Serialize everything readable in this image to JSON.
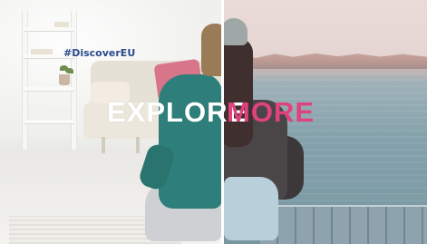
{
  "hashtag": "#DiscoverEU",
  "headline": {
    "left_word": "EXPLORE",
    "right_word": "MORE"
  },
  "colors": {
    "hashtag": "#2a4b8d",
    "left_word": "#ffffff",
    "right_word": "#e0427e"
  }
}
